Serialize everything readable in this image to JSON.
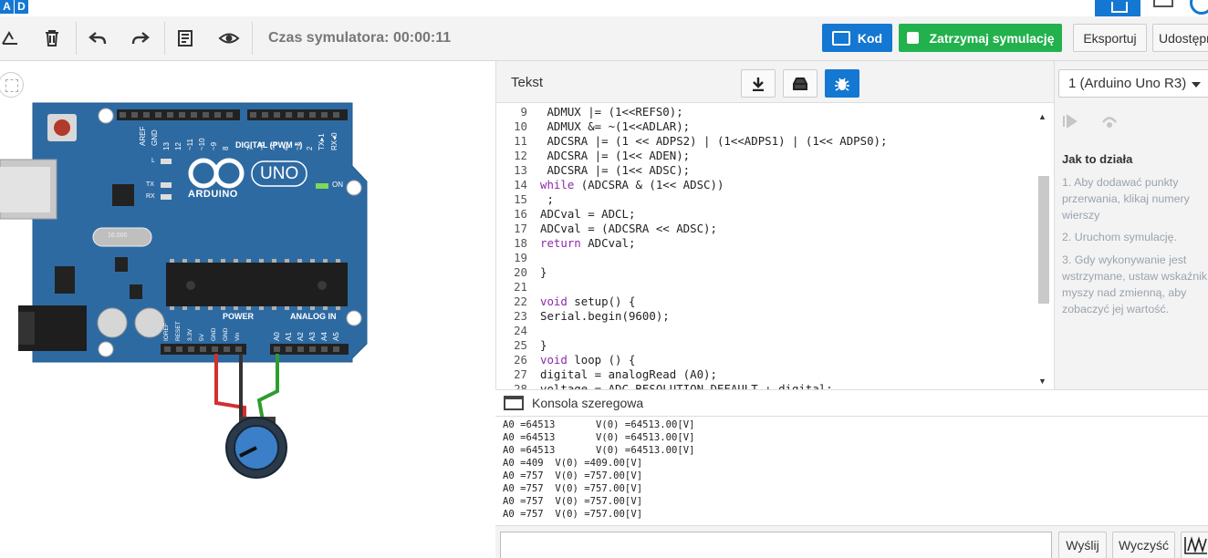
{
  "app": {
    "logo_letters": [
      "A",
      "D"
    ]
  },
  "toolbar": {
    "sim_time": "Czas symulatora: 00:00:11",
    "code_label": "Kod",
    "stop_label": "Zatrzymaj symulację",
    "export_label": "Eksportuj",
    "share_label": "Udostępnij",
    "tools": [
      "rotate-icon",
      "trash-icon",
      "undo-icon",
      "redo-icon",
      "notes-icon",
      "eye-icon"
    ]
  },
  "code": {
    "tab_label": "Tekst",
    "lines": [
      {
        "n": "9",
        "t": " ADMUX |= (1<<REFS0);",
        "kw": false
      },
      {
        "n": "10",
        "t": " ADMUX &= ~(1<<ADLAR);",
        "kw": false
      },
      {
        "n": "11",
        "t": " ADCSRA |= (1 << ADPS2) | (1<<ADPS1) | (1<< ADPS0);",
        "kw": false
      },
      {
        "n": "12",
        "t": " ADCSRA |= (1<< ADEN);",
        "kw": false
      },
      {
        "n": "13",
        "t": " ADCSRA |= (1<< ADSC);",
        "kw": false
      },
      {
        "n": "14",
        "t": "while (ADCSRA & (1<< ADSC))",
        "kw": "while"
      },
      {
        "n": "15",
        "t": " ;",
        "kw": false
      },
      {
        "n": "16",
        "t": "ADCval = ADCL;",
        "kw": false
      },
      {
        "n": "17",
        "t": "ADCval = (ADCSRA << ADSC);",
        "kw": false
      },
      {
        "n": "18",
        "t": "return ADCval;",
        "kw": "return"
      },
      {
        "n": "19",
        "t": "",
        "kw": false
      },
      {
        "n": "20",
        "t": "}",
        "kw": false
      },
      {
        "n": "21",
        "t": "",
        "kw": false
      },
      {
        "n": "22",
        "t": "void setup() {",
        "kw": "void"
      },
      {
        "n": "23",
        "t": "Serial.begin(9600);",
        "kw": false
      },
      {
        "n": "24",
        "t": "",
        "kw": false
      },
      {
        "n": "25",
        "t": "}",
        "kw": false
      },
      {
        "n": "26",
        "t": "void loop () {",
        "kw": "void"
      },
      {
        "n": "27",
        "t": "digital = analogRead (A0);",
        "kw": false
      },
      {
        "n": "28",
        "t": "voltage = ADC_RESOLUTION_DEFAULT + digital;",
        "kw": false
      }
    ]
  },
  "right": {
    "board": "1 (Arduino Uno R3)",
    "howto_title": "Jak to działa",
    "howto_items": [
      "1. Aby dodawać punkty przerwania, klikaj numery wierszy",
      "2. Uruchom symulację.",
      "3. Gdy wykonywanie jest wstrzymane, ustaw wskaźnik myszy nad zmienną, aby zobaczyć jej wartość."
    ]
  },
  "serial": {
    "title": "Konsola szeregowa",
    "output": [
      "A0 =64513       V(0) =64513.00[V]",
      "A0 =64513       V(0) =64513.00[V]",
      "A0 =64513       V(0) =64513.00[V]",
      "A0 =409  V(0) =409.00[V]",
      "A0 =757  V(0) =757.00[V]",
      "A0 =757  V(0) =757.00[V]",
      "A0 =757  V(0) =757.00[V]",
      "A0 =757  V(0) =757.00[V]"
    ],
    "input_value": "",
    "send_label": "Wyślij",
    "clear_label": "Wyczyść"
  },
  "board_labels": {
    "brand": "ARDUINO",
    "model": "UNO",
    "digital": "DIGITAL (PWM ~)",
    "power": "POWER",
    "analog": "ANALOG IN",
    "on": "ON",
    "l": "L",
    "tx": "TX",
    "rx": "RX",
    "aref": "AREF",
    "gnd": "GND",
    "crystal": "16.000",
    "dpins": [
      "13",
      "12",
      "~11",
      "~10",
      "~9",
      "8",
      "7",
      "~6",
      "~5",
      "4",
      "~3",
      "2",
      "TX▸1",
      "RX◂0"
    ],
    "ppins": [
      "IOREF",
      "RESET",
      "3.3V",
      "5V",
      "GND",
      "GND",
      "Vin"
    ],
    "apins": [
      "A0",
      "A1",
      "A2",
      "A3",
      "A4",
      "A5"
    ]
  },
  "colors": {
    "accent": "#1477d2",
    "green": "#22b14c",
    "board": "#2e6aa2",
    "wire_red": "#d32f2f",
    "wire_black": "#333333",
    "wire_green": "#2e9d2e"
  }
}
